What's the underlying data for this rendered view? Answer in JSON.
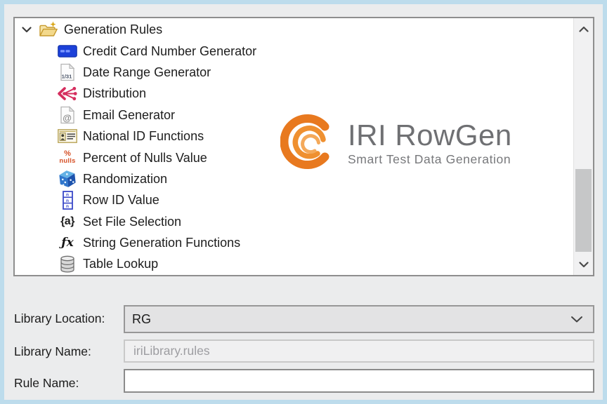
{
  "window": {
    "background": "#EBECED",
    "frame_color": "#BDDCEC"
  },
  "colors": {
    "brand_orange": "#E8791F",
    "logo_gray": "#6F7073",
    "tree_text": "#1D1D1D"
  },
  "watermark": {
    "logo_icon": "iri-swirl-icon",
    "title": "IRI RowGen",
    "subtitle": "Smart Test Data Generation"
  },
  "tree": {
    "items": [
      {
        "label": "Generation Rules",
        "icon": "folder-open-icon",
        "state": "expanded",
        "level": 0
      },
      {
        "label": "Credit Card Number Generator",
        "icon": "credit-card-icon",
        "level": 1
      },
      {
        "label": "Date Range Generator",
        "icon": "date-range-icon",
        "level": 1
      },
      {
        "label": "Distribution",
        "icon": "distribution-icon",
        "level": 1
      },
      {
        "label": "Email Generator",
        "icon": "email-icon",
        "level": 1
      },
      {
        "label": "National ID Functions",
        "icon": "national-id-icon",
        "level": 1
      },
      {
        "label": "Percent of Nulls Value",
        "icon": "percent-nulls-icon",
        "level": 1
      },
      {
        "label": "Randomization",
        "icon": "randomization-icon",
        "level": 1
      },
      {
        "label": "Row ID Value",
        "icon": "row-id-icon",
        "level": 1
      },
      {
        "label": "Set File Selection",
        "icon": "set-file-icon",
        "level": 1
      },
      {
        "label": "String Generation Functions",
        "icon": "string-functions-icon",
        "level": 1
      },
      {
        "label": "Table Lookup",
        "icon": "table-lookup-icon",
        "level": 1
      }
    ]
  },
  "icon_glyphs": {
    "date": "1/31",
    "percent": "%",
    "nulls": "nulls",
    "n": "n",
    "set_file": "{a}",
    "fx": "ƒx",
    "at": "@"
  },
  "scrollbar": {
    "orientation": "vertical",
    "up_icon": "chevron-up-icon",
    "down_icon": "chevron-down-icon"
  },
  "form": {
    "library_location": {
      "label": "Library Location:",
      "value": "RG"
    },
    "library_name": {
      "label": "Library Name:",
      "value": "iriLibrary.rules"
    },
    "rule_name": {
      "label": "Rule Name:",
      "value": ""
    }
  }
}
